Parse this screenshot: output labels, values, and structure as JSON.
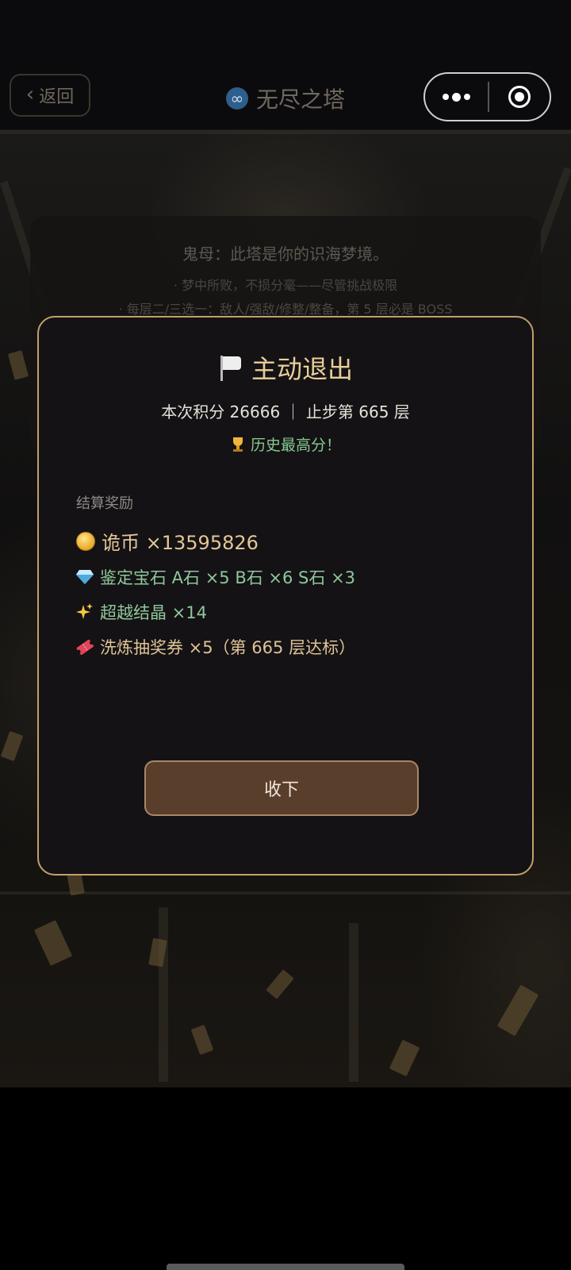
{
  "navbar": {
    "back_label": "返回",
    "title": "无尽之塔"
  },
  "info_card": {
    "line1": "鬼母：此塔是你的识海梦境。",
    "line2": "· 梦中所败，不损分毫——尽管挑战极限",
    "line3": "· 每层二/三选一：敌人/强敌/修整/整备，第 5 层必是 BOSS"
  },
  "modal": {
    "title": "主动退出",
    "score_line": "本次积分 26666 ｜ 止步第 665 层",
    "best_line": "历史最高分！",
    "rewards_label": "结算奖励",
    "rewards": {
      "coin": "诡币 ×13595826",
      "gem": "鉴定宝石 A石 ×5  B石 ×6  S石 ×3",
      "crystal": "超越结晶 ×14",
      "ticket": "洗炼抽奖券 ×5（第 665 层达标）"
    },
    "collect_label": "收下"
  },
  "icons": {
    "back": "chevron-left-icon",
    "title": "infinity-icon",
    "menu": "more-dots-icon",
    "close": "target-circle-icon",
    "flag": "white-flag-icon",
    "trophy": "trophy-icon",
    "coin": "coin-icon",
    "gem": "gem-icon",
    "crystal": "sparkles-icon",
    "ticket": "ticket-icon"
  },
  "colors": {
    "accent_gold": "#c2a06a",
    "title_gold": "#e8cf98",
    "green_text": "#86c98e",
    "button_brown": "#5a3e2c"
  }
}
